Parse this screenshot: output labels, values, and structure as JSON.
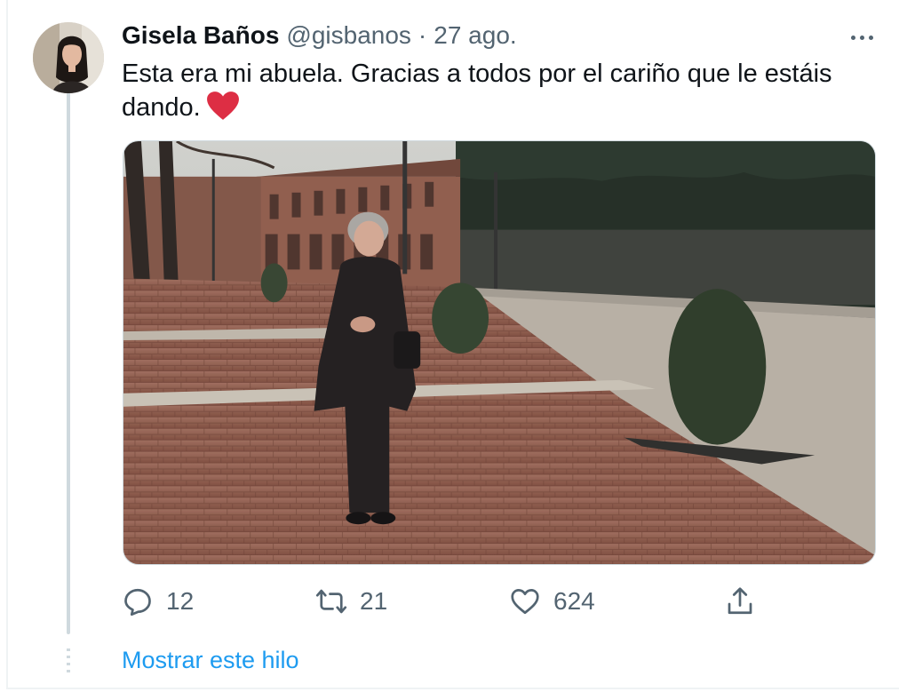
{
  "tweet": {
    "author_name": "Gisela Baños",
    "author_handle": "@gisbanos",
    "separator": "·",
    "date": "27 ago.",
    "text": "Esta era mi abuela. Gracias a todos por el cariño que le estáis dando.",
    "emoji": "red-heart",
    "more_icon": "more-horizontal-icon"
  },
  "actions": {
    "reply": {
      "icon": "reply-icon",
      "count": "12"
    },
    "retweet": {
      "icon": "retweet-icon",
      "count": "21"
    },
    "like": {
      "icon": "heart-outline-icon",
      "count": "624"
    },
    "share": {
      "icon": "share-icon"
    }
  },
  "thread": {
    "show_thread_label": "Mostrar este hilo"
  },
  "colors": {
    "text_primary": "#0f1419",
    "text_secondary": "#536471",
    "link": "#1d9bf0",
    "heart": "#e0245e",
    "border": "#cfd9de"
  }
}
